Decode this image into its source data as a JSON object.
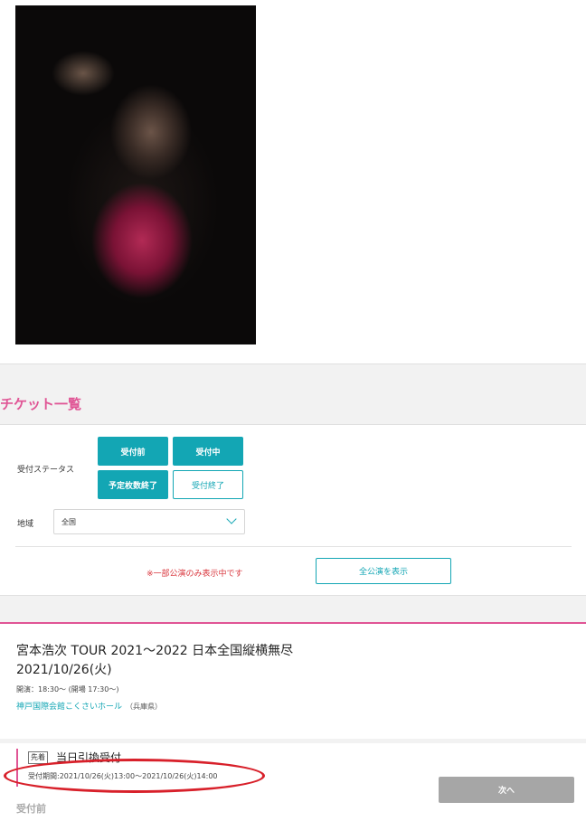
{
  "section": {
    "title": "チケット一覧"
  },
  "filters": {
    "status_label": "受付ステータス",
    "status_buttons": [
      {
        "label": "受付前",
        "active": true
      },
      {
        "label": "受付中",
        "active": true
      },
      {
        "label": "予定枚数終了",
        "active": true
      },
      {
        "label": "受付終了",
        "active": false
      }
    ],
    "region_label": "地域",
    "region_value": "全国",
    "notice": "※一部公演のみ表示中です",
    "show_all_label": "全公演を表示"
  },
  "event": {
    "title": "宮本浩次 TOUR 2021～2022 日本全国縦横無尽",
    "date": "2021/10/26(火)",
    "time": "開演：18:30～ (開場 17:30～)",
    "venue": "神戸国際会館こくさいホール",
    "prefecture": "（兵庫県）"
  },
  "sale": {
    "badge": "先着",
    "title": "当日引換受付",
    "period": "受付期間:2021/10/26(火)13:00～2021/10/26(火)14:00",
    "next_label": "次へ",
    "status": "受付前"
  },
  "colors": {
    "accent": "#13a6b4",
    "pink": "#e05595",
    "alert": "#d9353c",
    "highlight": "#d8202a"
  }
}
